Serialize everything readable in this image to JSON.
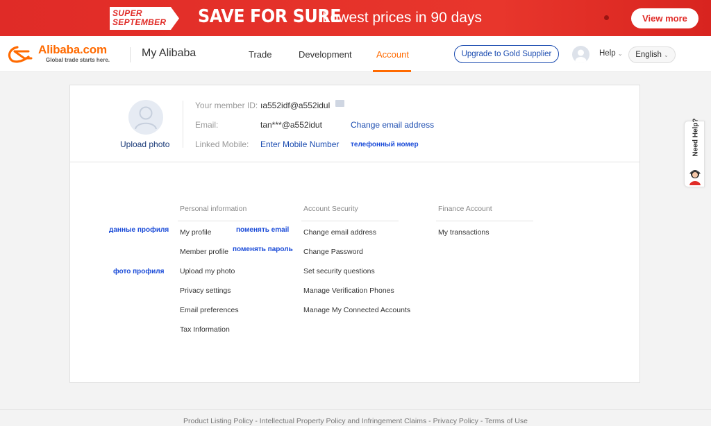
{
  "banner": {
    "super_line1": "SUPER",
    "super_line2": "SEPTEMBER",
    "headline": "SAVE FOR SURE",
    "subtext": "Lowest prices in 90 days",
    "button": "View more",
    "bg_color": "#e02b27"
  },
  "header": {
    "logo_text": "Alibaba.com",
    "logo_tagline": "Global trade starts here.",
    "site_title": "My Alibaba",
    "nav": [
      {
        "label": "Trade"
      },
      {
        "label": "Development"
      },
      {
        "label": "Account",
        "active": true
      }
    ],
    "upgrade_button": "Upgrade to Gold Supplier",
    "help": "Help",
    "language": "English",
    "accent_color": "#ff6a00"
  },
  "profile": {
    "upload_photo": "Upload photo",
    "member_id_label": "Your member ID:",
    "member_id_value": "ıa552idf@a552idul",
    "email_label": "Email:",
    "email_value": "tan***@a552idut",
    "change_email": "Change email address",
    "mobile_label": "Linked Mobile:",
    "mobile_value": "Enter Mobile Number",
    "mobile_note": "телефонный номер"
  },
  "annotations": {
    "profile_data": "данные профиля",
    "change_email": "поменять email",
    "change_password": "поменять пароль",
    "profile_photo": "фото профиля"
  },
  "sections": {
    "personal": {
      "title": "Personal information",
      "items": [
        "My profile",
        "Member profile",
        "Upload my photo",
        "Privacy settings",
        "Email preferences",
        "Tax Information"
      ]
    },
    "security": {
      "title": "Account Security",
      "items": [
        "Change email address",
        "Change Password",
        "Set security questions",
        "Manage Verification Phones",
        "Manage My Connected Accounts"
      ]
    },
    "finance": {
      "title": "Finance Account",
      "items": [
        "My transactions"
      ]
    }
  },
  "need_help": "Need Help?",
  "footer": {
    "links": [
      "Product Listing Policy",
      "Intellectual Property Policy and Infringement Claims",
      "Privacy Policy",
      "Terms of Use"
    ],
    "separator": " - "
  }
}
